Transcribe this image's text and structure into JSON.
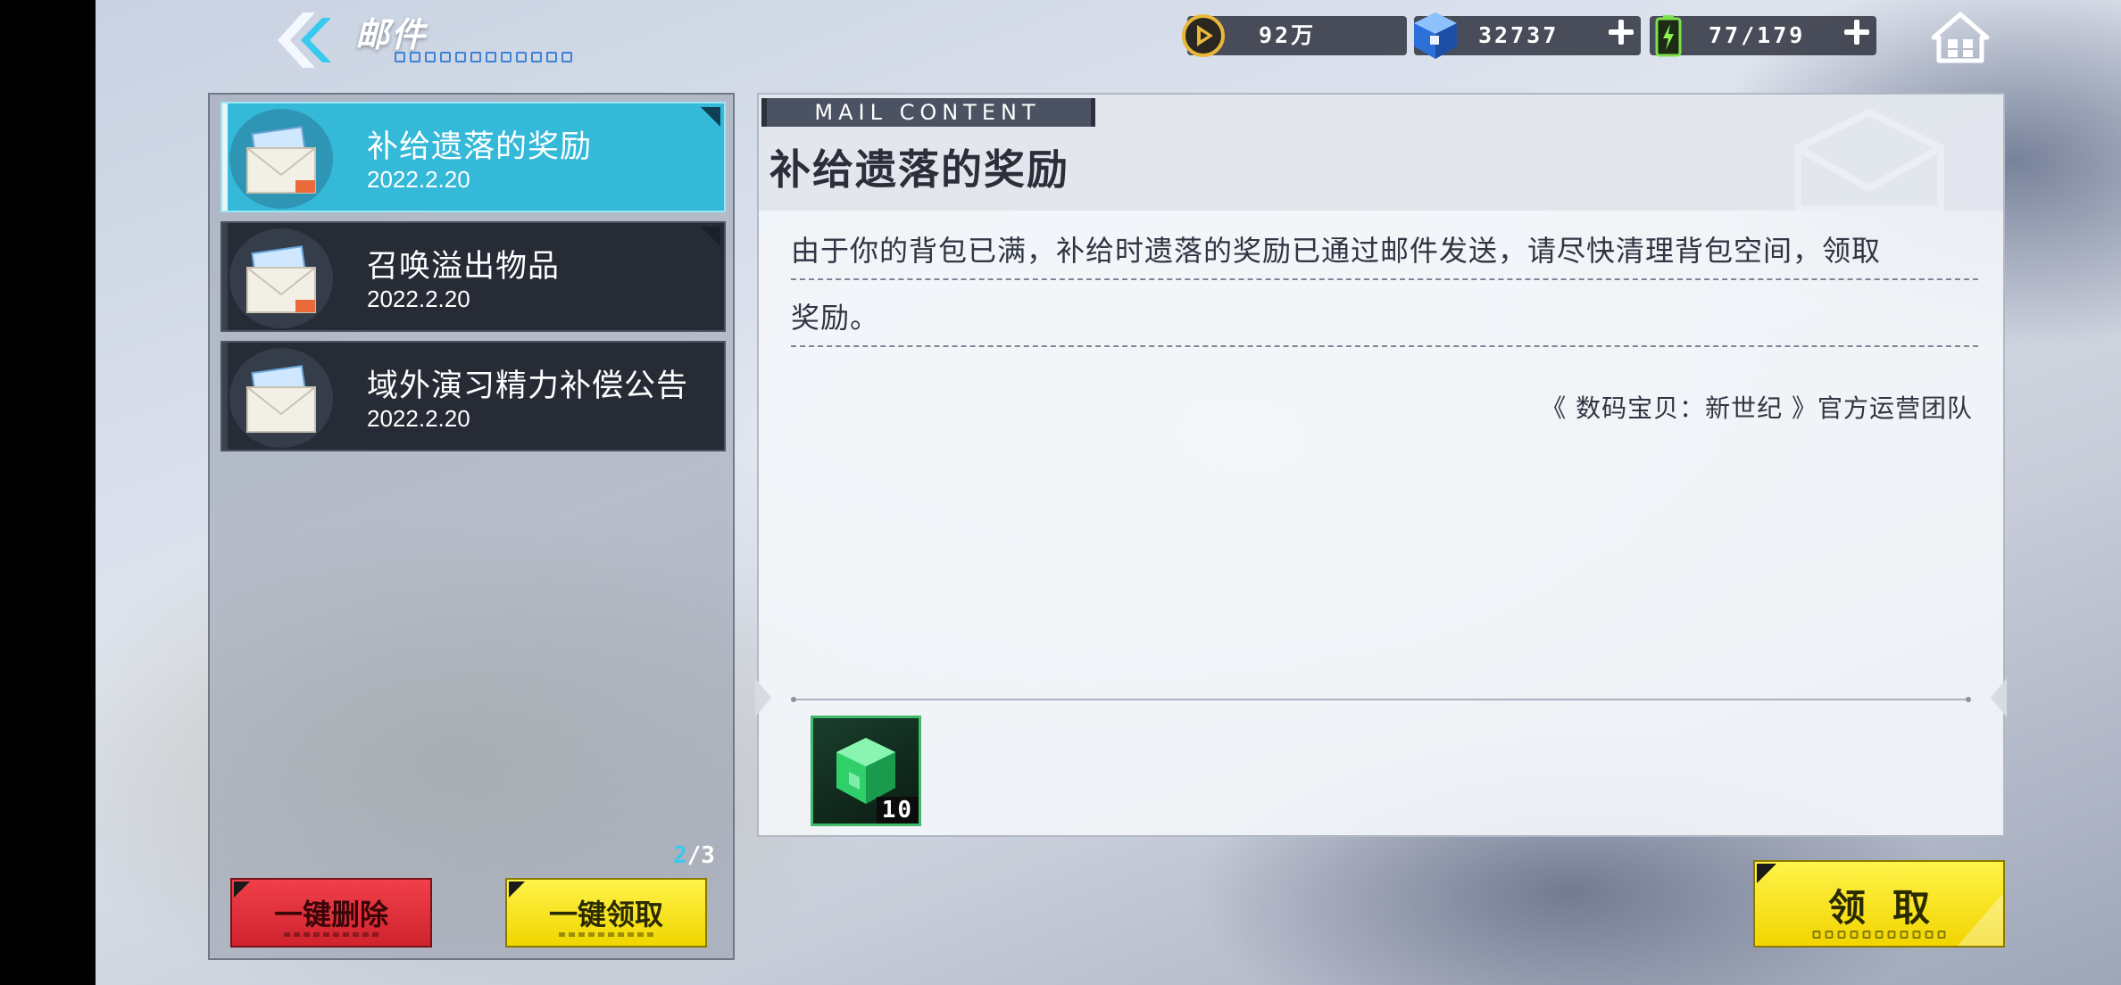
{
  "header": {
    "title": "邮件",
    "resources": [
      {
        "name": "coin",
        "value": "92万",
        "icon": "coin-icon"
      },
      {
        "name": "gem",
        "value": "32737",
        "icon": "cube-icon"
      },
      {
        "name": "stamina",
        "value": "77/179",
        "icon": "battery-icon"
      }
    ]
  },
  "mail_list": {
    "items": [
      {
        "title": "补给遗落的奖励",
        "date": "2022.2.20",
        "selected": true,
        "has_attachment": true
      },
      {
        "title": "召唤溢出物品",
        "date": "2022.2.20",
        "selected": false,
        "has_attachment": true
      },
      {
        "title": "域外演习精力补偿公告",
        "date": "2022.2.20",
        "selected": false,
        "has_attachment": false
      }
    ],
    "page": {
      "current": "2",
      "total": "/3"
    },
    "delete_all_label": "一键删除",
    "claim_all_label": "一键领取"
  },
  "mail_content": {
    "section_tag": "MAIL CONTENT",
    "title": "补给遗落的奖励",
    "body_lines": [
      "由于你的背包已满，补给时遗落的奖励已通过邮件发送，请尽快清理背包空间，领取",
      "奖励。"
    ],
    "sender": "《 数码宝贝：新世纪 》官方运营团队",
    "rewards": [
      {
        "icon": "green-cube-icon",
        "quantity": "10"
      }
    ],
    "claim_label": "领取"
  },
  "colors": {
    "selected_item": "#35b9d9",
    "item_bg": "#262b36",
    "delete_button": "#e0303a",
    "claim_button": "#f7e224",
    "accent_blue": "#37c9ee"
  }
}
